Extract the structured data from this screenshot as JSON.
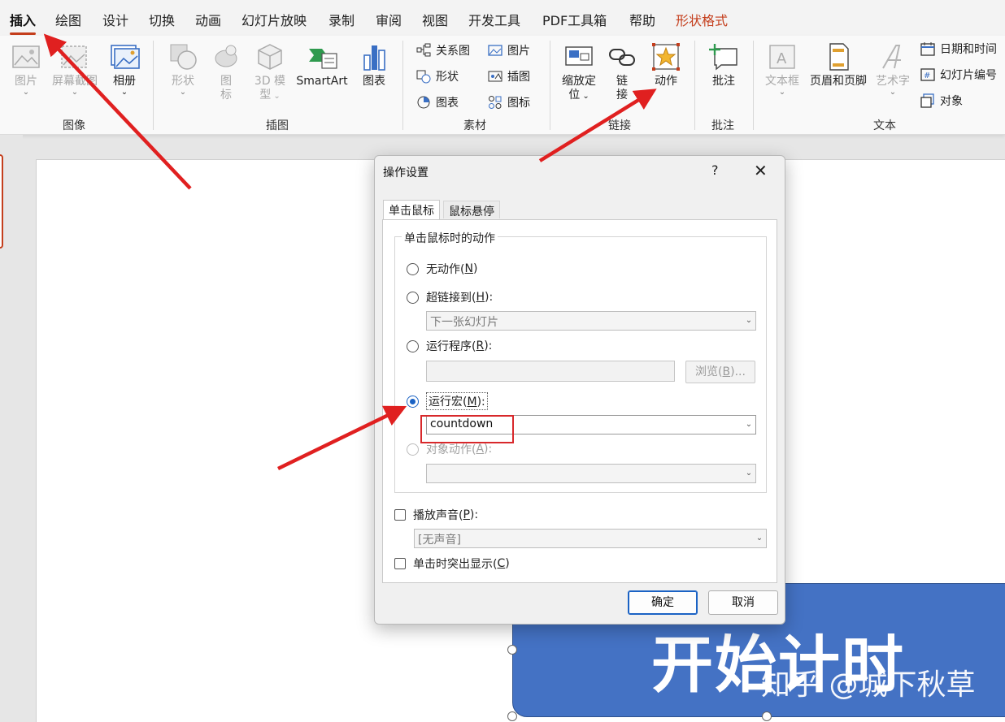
{
  "tabs": [
    {
      "label": "插入",
      "active": true
    },
    {
      "label": "绘图"
    },
    {
      "label": "设计"
    },
    {
      "label": "切换"
    },
    {
      "label": "动画"
    },
    {
      "label": "幻灯片放映"
    },
    {
      "label": "录制"
    },
    {
      "label": "审阅"
    },
    {
      "label": "视图"
    },
    {
      "label": "开发工具"
    },
    {
      "label": "PDF工具箱"
    },
    {
      "label": "帮助"
    },
    {
      "label": "形状格式",
      "contextual": true
    }
  ],
  "ribbon": {
    "images": {
      "group_label": "图像",
      "picture": "图片",
      "screenshot": "屏幕截图",
      "album": "相册"
    },
    "illustrations": {
      "group_label": "插图",
      "shapes": "形状",
      "icons_l1": "图",
      "icons_l2": "标",
      "model_l1": "3D 模",
      "model_l2": "型",
      "smartart": "SmartArt",
      "chart": "图表"
    },
    "assets": {
      "group_label": "素材",
      "relation_chart": "关系图",
      "picture": "图片",
      "shape": "形状",
      "illustration": "插图",
      "chart": "图表",
      "icon": "图标"
    },
    "links": {
      "group_label": "链接",
      "zoom_l1": "缩放定",
      "zoom_l2": "位",
      "link_l1": "链",
      "link_l2": "接",
      "action": "动作"
    },
    "comments": {
      "group_label": "批注",
      "comment": "批注"
    },
    "text": {
      "group_label": "文本",
      "textbox": "文本框",
      "header_footer": "页眉和页脚",
      "wordart": "艺术字",
      "datetime": "日期和时间",
      "slide_number": "幻灯片编号",
      "object": "对象"
    }
  },
  "colors": {
    "accent": "#c43e1c",
    "shape_fill": "#4472c4",
    "annotation_arrow": "#e02020",
    "dialog_primary": "#1a62c4"
  },
  "slide": {
    "button_text": "开始计时"
  },
  "watermark": "知乎 @城下秋草",
  "dialog": {
    "title": "操作设置",
    "help": "?",
    "close": "✕",
    "tabs": [
      "单击鼠标",
      "鼠标悬停"
    ],
    "section_label": "单击鼠标时的动作",
    "options": {
      "none": {
        "label": "无动作(",
        "key": "N",
        "end": ")"
      },
      "hyperlink": {
        "label": "超链接到(",
        "key": "H",
        "end": "):",
        "value": "下一张幻灯片"
      },
      "run_program": {
        "label": "运行程序(",
        "key": "R",
        "end": "):",
        "browse_label": "浏览(",
        "browse_key": "B",
        "browse_end": ")..."
      },
      "run_macro": {
        "label": "运行宏(",
        "key": "M",
        "end": "):",
        "value": "countdown",
        "selected": true
      },
      "object_action": {
        "label": "对象动作(",
        "key": "A",
        "end": "):"
      }
    },
    "play_sound": {
      "label": "播放声音(",
      "key": "P",
      "end": "):",
      "value": "[无声音]",
      "checked": false
    },
    "highlight": {
      "label": "单击时突出显示(",
      "key": "C",
      "end": ")",
      "checked": false
    },
    "ok": "确定",
    "cancel": "取消"
  }
}
